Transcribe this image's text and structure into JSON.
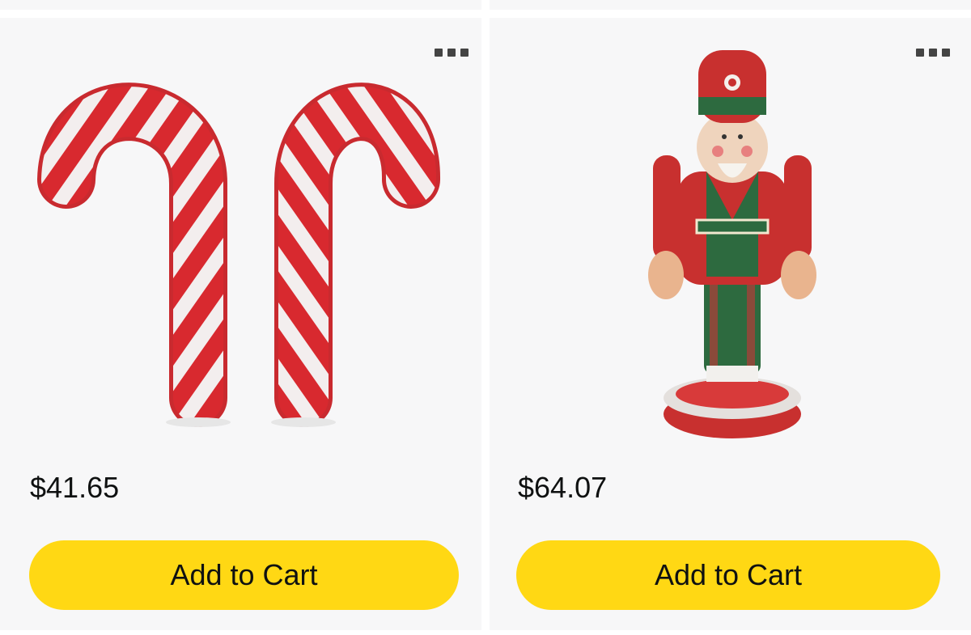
{
  "products": [
    {
      "image_icon": "candy-cane-pair-image",
      "price": "$41.65",
      "add_label": "Add to Cart"
    },
    {
      "image_icon": "nutcracker-image",
      "price": "$64.07",
      "add_label": "Add to Cart"
    }
  ],
  "colors": {
    "button": "#ffd814",
    "card_bg": "#f7f7f8",
    "text": "#0f1111"
  }
}
